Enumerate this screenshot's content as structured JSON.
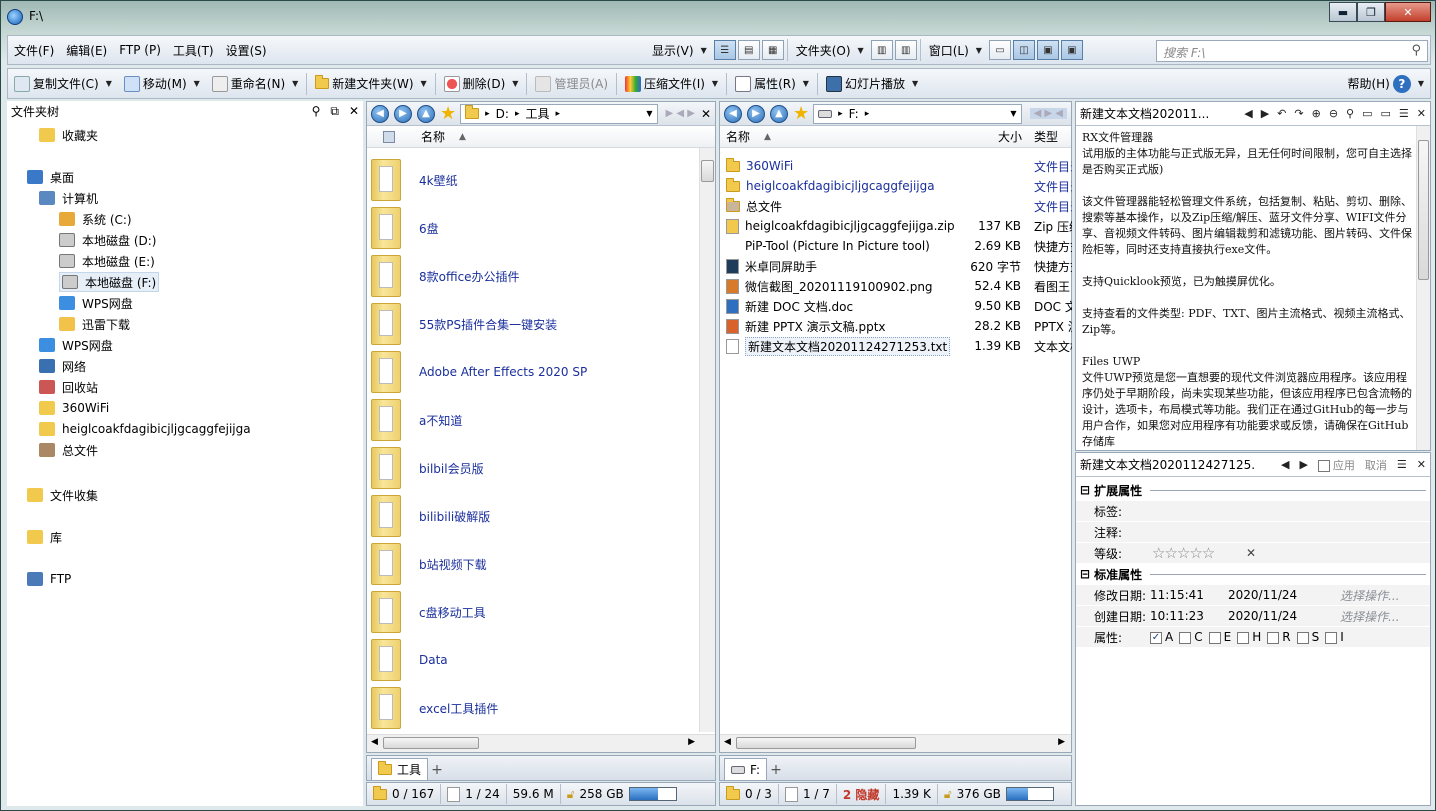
{
  "window": {
    "title": "F:\\"
  },
  "menu": [
    "文件(F)",
    "编辑(E)",
    "FTP (P)",
    "工具(T)",
    "设置(S)"
  ],
  "view_menu": {
    "display": "显示(V)",
    "folder": "文件夹(O)",
    "window": "窗口(L)"
  },
  "search": {
    "placeholder": "搜索 F:\\"
  },
  "toolbar": {
    "copy": "复制文件(C)",
    "move": "移动(M)",
    "rename": "重命名(N)",
    "new_folder": "新建文件夹(W)",
    "delete": "删除(D)",
    "admin": "管理员(A)",
    "compress": "压缩文件(I)",
    "props": "属性(R)",
    "slideshow": "幻灯片播放",
    "help": "帮助(H)"
  },
  "tree": {
    "header": "文件夹树",
    "items": [
      "收藏夹",
      "桌面",
      "计算机",
      "系统 (C:)",
      "本地磁盘 (D:)",
      "本地磁盘 (E:)",
      "本地磁盘 (F:)",
      "WPS网盘",
      "迅雷下载",
      "WPS网盘",
      "网络",
      "回收站",
      "360WiFi",
      "heiglcoakfdagibicjljgcaggfejijga",
      "总文件",
      "文件收集",
      "库",
      "FTP"
    ]
  },
  "left_pane": {
    "path": [
      "D:",
      "工具"
    ],
    "col_name": "名称",
    "items": [
      "4k壁纸",
      "6盘",
      "8款office办公插件",
      "55款PS插件合集一键安装",
      "Adobe After Effects 2020 SP",
      "a不知道",
      "bilbil会员版",
      "bilibili破解版",
      "b站视频下载",
      "c盘移动工具",
      "Data",
      "excel工具插件"
    ],
    "tab": "工具",
    "status": {
      "sel": "0 / 167",
      "files": "1 / 24",
      "size": "59.6 M",
      "free": "258 GB",
      "used_fraction": 0.62
    }
  },
  "right_pane": {
    "path": [
      "F:"
    ],
    "col_name": "名称",
    "col_size": "大小",
    "col_type": "类型",
    "rows": [
      {
        "name": "360WiFi",
        "size": "",
        "type": "文件目录",
        "kind": "folder"
      },
      {
        "name": "heiglcoakfdagibicjljgcaggfejijga",
        "size": "",
        "type": "文件目录",
        "kind": "folder"
      },
      {
        "name": "总文件",
        "size": "",
        "type": "文件目录",
        "kind": "special"
      },
      {
        "name": "heiglcoakfdagibicjljgcaggfejijga.zip",
        "size": "137 KB",
        "type": "Zip 压缩",
        "kind": "zip"
      },
      {
        "name": "PiP-Tool  (Picture In Picture tool)",
        "size": "2.69 KB",
        "type": "快捷方式",
        "kind": "none"
      },
      {
        "name": "米卓同屏助手",
        "size": "620 字节",
        "type": "快捷方式",
        "kind": "app"
      },
      {
        "name": "微信截图_20201119100902.png",
        "size": "52.4 KB",
        "type": "看图王",
        "kind": "png"
      },
      {
        "name": "新建 DOC 文档.doc",
        "size": "9.50 KB",
        "type": "DOC 文档",
        "kind": "doc"
      },
      {
        "name": "新建 PPTX 演示文稿.pptx",
        "size": "28.2 KB",
        "type": "PPTX 演示",
        "kind": "ppt"
      },
      {
        "name": "新建文本文档20201124271253.txt",
        "size": "1.39 KB",
        "type": "文本文档",
        "kind": "txt"
      }
    ],
    "tab": "F:",
    "status": {
      "sel": "0 / 3",
      "files": "1 / 7",
      "hidden": "2 隐藏",
      "size": "1.39 K",
      "free": "376 GB",
      "used_fraction": 0.45
    }
  },
  "preview": {
    "title": "新建文本文档202011...",
    "text": "RX文件管理器\n试用版的主体功能与正式版无异，且无任何时间限制，您可自主选择是否购买正式版)\n\n该文件管理器能轻松管理文件系统，包括复制、粘贴、剪切、删除、搜索等基本操作，以及Zip压缩/解压、蓝牙文件分享、WIFI文件分享、音视频文件转码、图片编辑裁剪和滤镜功能、图片转码、文件保险柜等，同时还支持直接执行exe文件。\n\n支持Quicklook预览，已为触摸屏优化。\n\n支持查看的文件类型: PDF、TXT、图片主流格式、视频主流格式、Zip等。\n\nFiles UWP\n文件UWP预览是您一直想要的现代文件浏览器应用程序。该应用程序仍处于早期阶段，尚未实现某些功能，但该应用程序已包含流畅的设计，选项卡，布局模式等功能。我们正在通过GitHub的每一步与用户合作，如果您对应用程序有功能要求或反馈，请确保在GitHub存储库"
  },
  "props": {
    "title": "新建文本文档2020112427125...",
    "apply": "应用",
    "cancel": "取消",
    "ext_section": "扩展属性",
    "tag": "标签:",
    "note": "注释:",
    "rating": "等级:",
    "stars": "☆☆☆☆☆",
    "std_section": "标准属性",
    "modified": "修改日期:",
    "modified_time": "11:15:41",
    "modified_date": "2020/11/24",
    "created": "创建日期:",
    "created_time": "10:11:23",
    "created_date": "2020/11/24",
    "choose": "选择操作...",
    "attr": "属性:",
    "attrs": [
      "A",
      "C",
      "E",
      "H",
      "R",
      "S",
      "I"
    ]
  },
  "colors": {
    "link": "#1a2f9c",
    "hidden": "#c0392b"
  }
}
